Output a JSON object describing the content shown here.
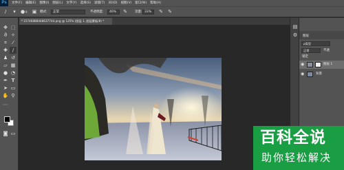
{
  "app": {
    "logo": "Ps"
  },
  "menu": [
    "文件(F)",
    "编辑(E)",
    "图像(I)",
    "图层(L)",
    "文字(Y)",
    "选择(S)",
    "滤镜(T)",
    "3D(D)",
    "视图(V)",
    "窗口(W)",
    "帮助(H)"
  ],
  "options_bar": {
    "brush_size": "9",
    "mode_label": "模式:",
    "mode_value": "正常",
    "opacity_label": "不透明度:",
    "opacity_value": "40%",
    "flow_label": "流量:",
    "flow_value": "33%"
  },
  "document": {
    "tab_title": "15746888448637744.png @ 125% (图层 1, 图层蒙板/8) *",
    "close_glyph": "×"
  },
  "layers_panel": {
    "tab_label": "图层",
    "kind_filter": "ρ类型",
    "blend_mode": "正常",
    "opacity_short": "不透",
    "lock_label": "锁定",
    "layers": [
      {
        "name": "图层 1",
        "active": true
      },
      {
        "name": "背景",
        "active": false
      }
    ]
  },
  "watermark": {
    "title": "百科全说",
    "subtitle": "助你轻松解决"
  },
  "colors": {
    "ui_dark": "#282828",
    "ui_panel": "#535353",
    "watermark_green": "#1a9e43"
  }
}
